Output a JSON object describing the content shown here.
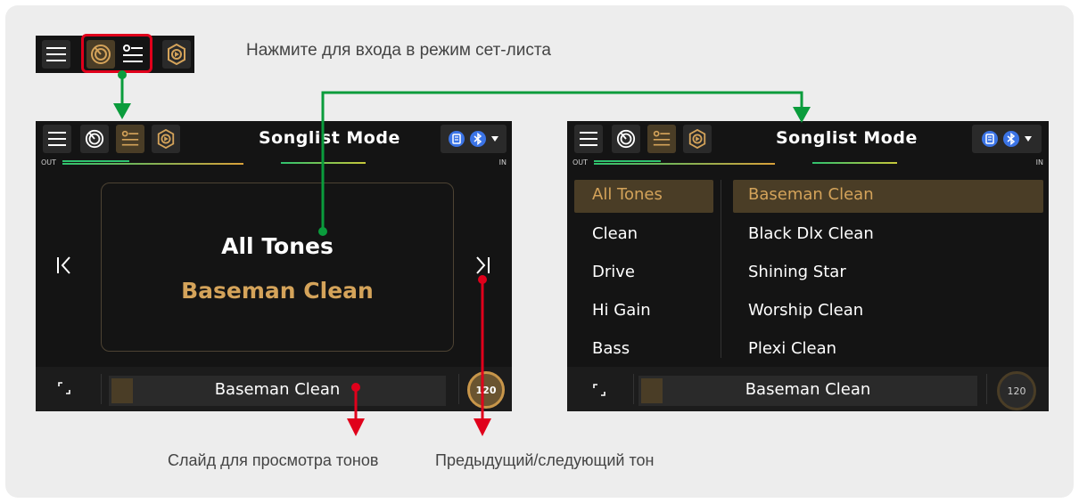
{
  "colors": {
    "accent_gold": "#d4a35a",
    "annotation_green": "#0a9c3c",
    "annotation_red": "#e0001b",
    "screen_bg": "#141414"
  },
  "annotations": {
    "enter_songlist": "Нажмите для входа в режим сет-листа",
    "slide_tones": "Слайд для просмотра тонов",
    "prev_next_tone": "Предыдущий/следующий тон"
  },
  "left_screen": {
    "title": "Songlist Mode",
    "meter_out": "OUT",
    "meter_in": "IN",
    "bank": "All Tones",
    "tone": "Baseman Clean",
    "current_tone": "Baseman Clean",
    "tempo": "120",
    "icons": [
      "menu-icon",
      "tuner-icon",
      "songlist-icon",
      "play-icon",
      "list-icon",
      "bluetooth-icon",
      "caret-down-icon",
      "prev-icon",
      "next-icon",
      "loop-icon"
    ]
  },
  "right_screen": {
    "title": "Songlist Mode",
    "meter_out": "OUT",
    "meter_in": "IN",
    "categories": [
      "All Tones",
      "Clean",
      "Drive",
      "Hi Gain",
      "Bass"
    ],
    "selected_category": "All Tones",
    "tones": [
      "Baseman Clean",
      "Black Dlx Clean",
      "Shining Star",
      "Worship Clean",
      "Plexi Clean"
    ],
    "selected_tone": "Baseman Clean",
    "current_tone": "Baseman Clean",
    "tempo": "120"
  }
}
